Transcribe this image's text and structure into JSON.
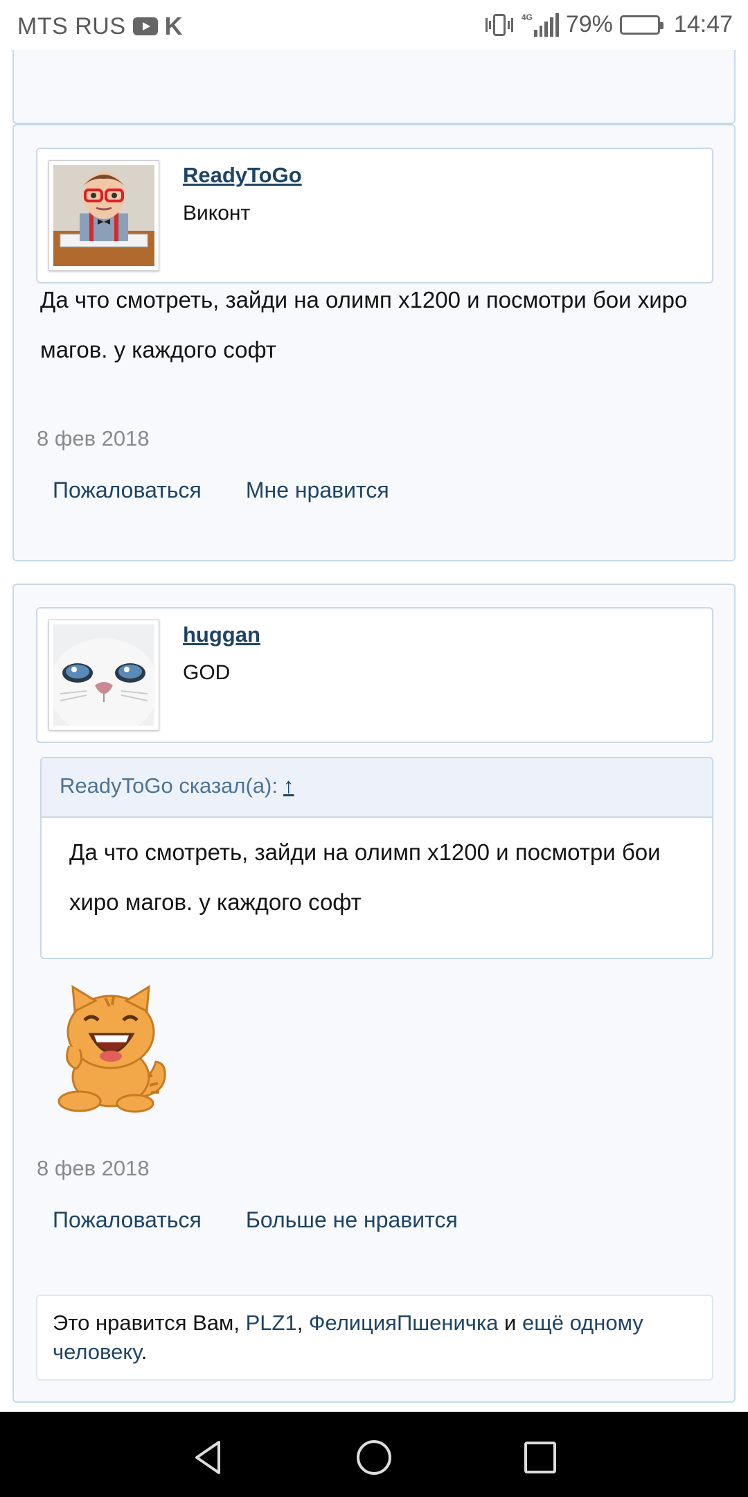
{
  "status_bar": {
    "carrier": "MTS RUS",
    "network": "4G",
    "battery": "79%",
    "time": "14:47"
  },
  "posts": [
    {
      "user": {
        "name": "ReadyToGo",
        "title": "Виконт",
        "avatar": "nerd-avatar"
      },
      "message": "Да что смотреть, зайди на олимп x1200 и посмотри бои хиро магов. у каждого софт",
      "date": "8 фев 2018",
      "actions": {
        "report": "Пожаловаться",
        "like": "Мне нравится"
      }
    },
    {
      "user": {
        "name": "huggan",
        "title": "GOD",
        "avatar": "kitten-avatar"
      },
      "quote": {
        "author": "ReadyToGo сказал(а):",
        "jump": "↑",
        "text": "Да что смотреть, зайди на олимп x1200 и посмотри бои хиро магов. у каждого софт"
      },
      "sticker": "laughing-cat-sticker",
      "date": "8 фев 2018",
      "actions": {
        "report": "Пожаловаться",
        "like": "Больше не нравится"
      },
      "likes": {
        "prefix": "Это нравится Вам, ",
        "user1": "PLZ1",
        "sep1": ", ",
        "user2": "ФелицияПшеничка",
        "sep2": " и ",
        "more": "ещё одному человеку",
        "end": "."
      }
    }
  ],
  "nav": {
    "back": "back-icon",
    "home": "home-icon",
    "recents": "recents-icon"
  },
  "colors": {
    "link": "#1e4466",
    "border": "#c7d9e8",
    "post_bg": "#f8f9fd",
    "quote_head": "#edf2fa"
  }
}
